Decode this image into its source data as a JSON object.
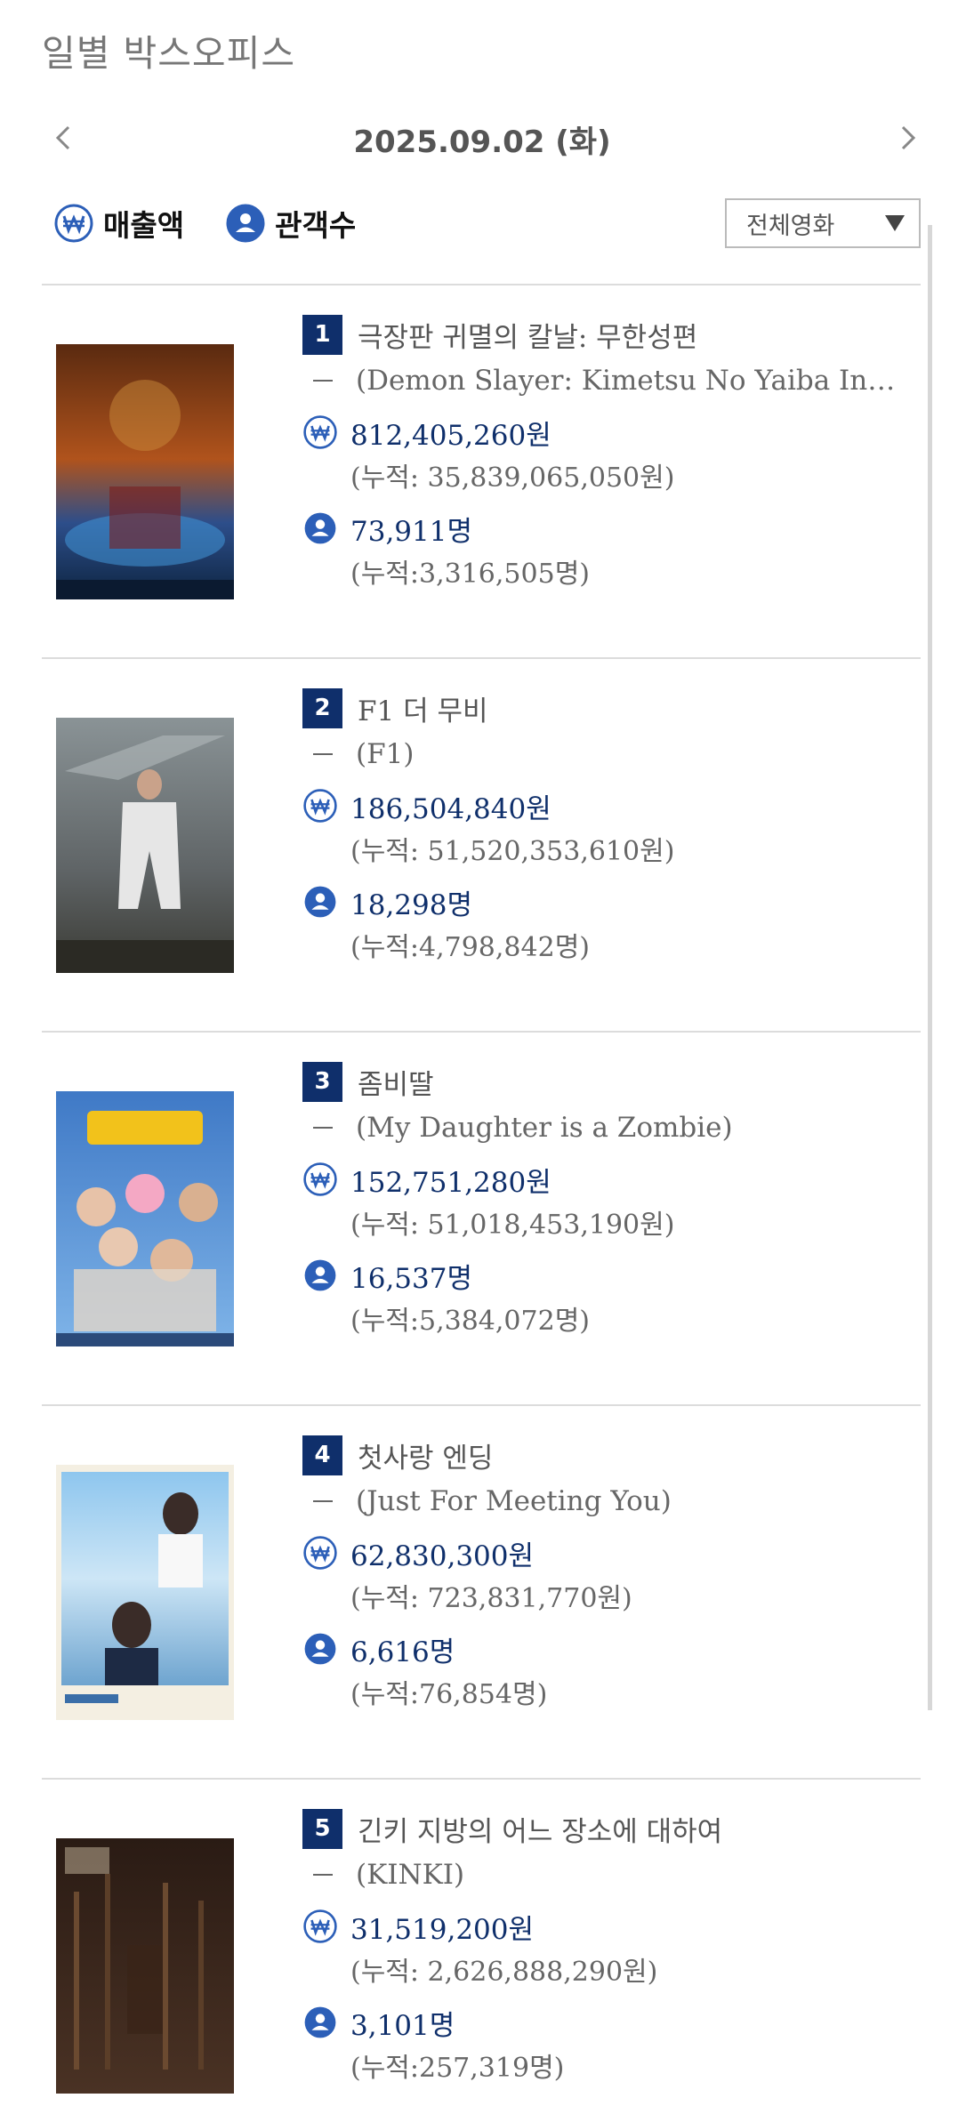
{
  "header": {
    "title": "일별 박스오피스"
  },
  "date_nav": {
    "date": "2025.09.02 (화)",
    "prev_icon": "chevron-left-icon",
    "next_icon": "chevron-right-icon"
  },
  "toggles": {
    "sales_label": "매출액",
    "audience_label": "관객수"
  },
  "filter": {
    "selected": "전체영화"
  },
  "colors": {
    "accent": "#0f2f6b",
    "icon_blue": "#2c5fb8"
  },
  "movies": [
    {
      "rank": "1",
      "title": "극장판 귀멸의 칼날: 무한성편",
      "original": "(Demon Slayer: Kimetsu No Yaiba Infinity Castle)",
      "sales": "812,405,260원",
      "sales_cum": "(누적: 35,839,065,050원)",
      "audience": "73,911명",
      "audience_cum": "(누적:3,316,505명)"
    },
    {
      "rank": "2",
      "title": "F1 더 무비",
      "original": "(F1)",
      "sales": "186,504,840원",
      "sales_cum": "(누적: 51,520,353,610원)",
      "audience": "18,298명",
      "audience_cum": "(누적:4,798,842명)"
    },
    {
      "rank": "3",
      "title": "좀비딸",
      "original": "(My Daughter is a Zombie)",
      "sales": "152,751,280원",
      "sales_cum": "(누적: 51,018,453,190원)",
      "audience": "16,537명",
      "audience_cum": "(누적:5,384,072명)"
    },
    {
      "rank": "4",
      "title": "첫사랑 엔딩",
      "original": "(Just For Meeting You)",
      "sales": "62,830,300원",
      "sales_cum": "(누적: 723,831,770원)",
      "audience": "6,616명",
      "audience_cum": "(누적:76,854명)"
    },
    {
      "rank": "5",
      "title": "긴키 지방의 어느 장소에 대하여",
      "original": "(KINKI)",
      "sales": "31,519,200원",
      "sales_cum": "(누적: 2,626,888,290원)",
      "audience": "3,101명",
      "audience_cum": "(누적:257,319명)"
    }
  ]
}
